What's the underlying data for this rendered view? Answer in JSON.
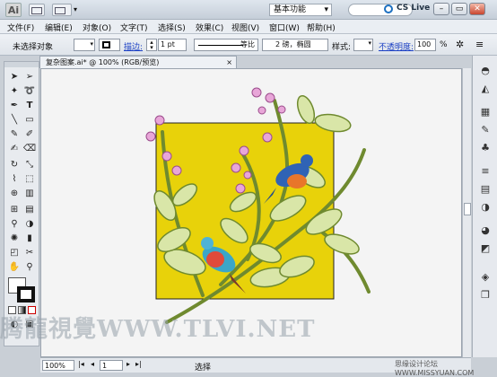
{
  "app": {
    "logo": "Ai"
  },
  "titlebar": {
    "workspace": "基本功能",
    "cs_live": "CS Live",
    "win_buttons": [
      "–",
      "▭",
      "✕"
    ]
  },
  "menubar": {
    "items": [
      "文件(F)",
      "编辑(E)",
      "对象(O)",
      "文字(T)",
      "选择(S)",
      "效果(C)",
      "视图(V)",
      "窗口(W)",
      "帮助(H)"
    ]
  },
  "controlbar": {
    "selection_label": "未选择对象",
    "stroke_label": "描边:",
    "stroke_value": "1 pt",
    "profile_value": "等比",
    "brush_value": "2 磅，椭圆",
    "style_label": "样式:",
    "opacity_label": "不透明度:",
    "opacity_value": "100",
    "percent": "%"
  },
  "document": {
    "tab_title": "复杂图案.ai* @ 100% (RGB/预览)",
    "close": "×"
  },
  "statusbar": {
    "zoom": "100%",
    "page": "1",
    "status": "选择"
  },
  "watermark": {
    "text": "腾龍視覺WWW.TLVI.NET",
    "site": "思缘设计论坛 WWW.MISSYUAN.COM"
  },
  "colors": {
    "background_square": "#e8d20a",
    "leaf": "#d9e6a8",
    "stem": "#6f8a2f",
    "flower": "#e8a6d8",
    "bird_blue": "#2f63b5",
    "bird_orange": "#e8762a"
  }
}
